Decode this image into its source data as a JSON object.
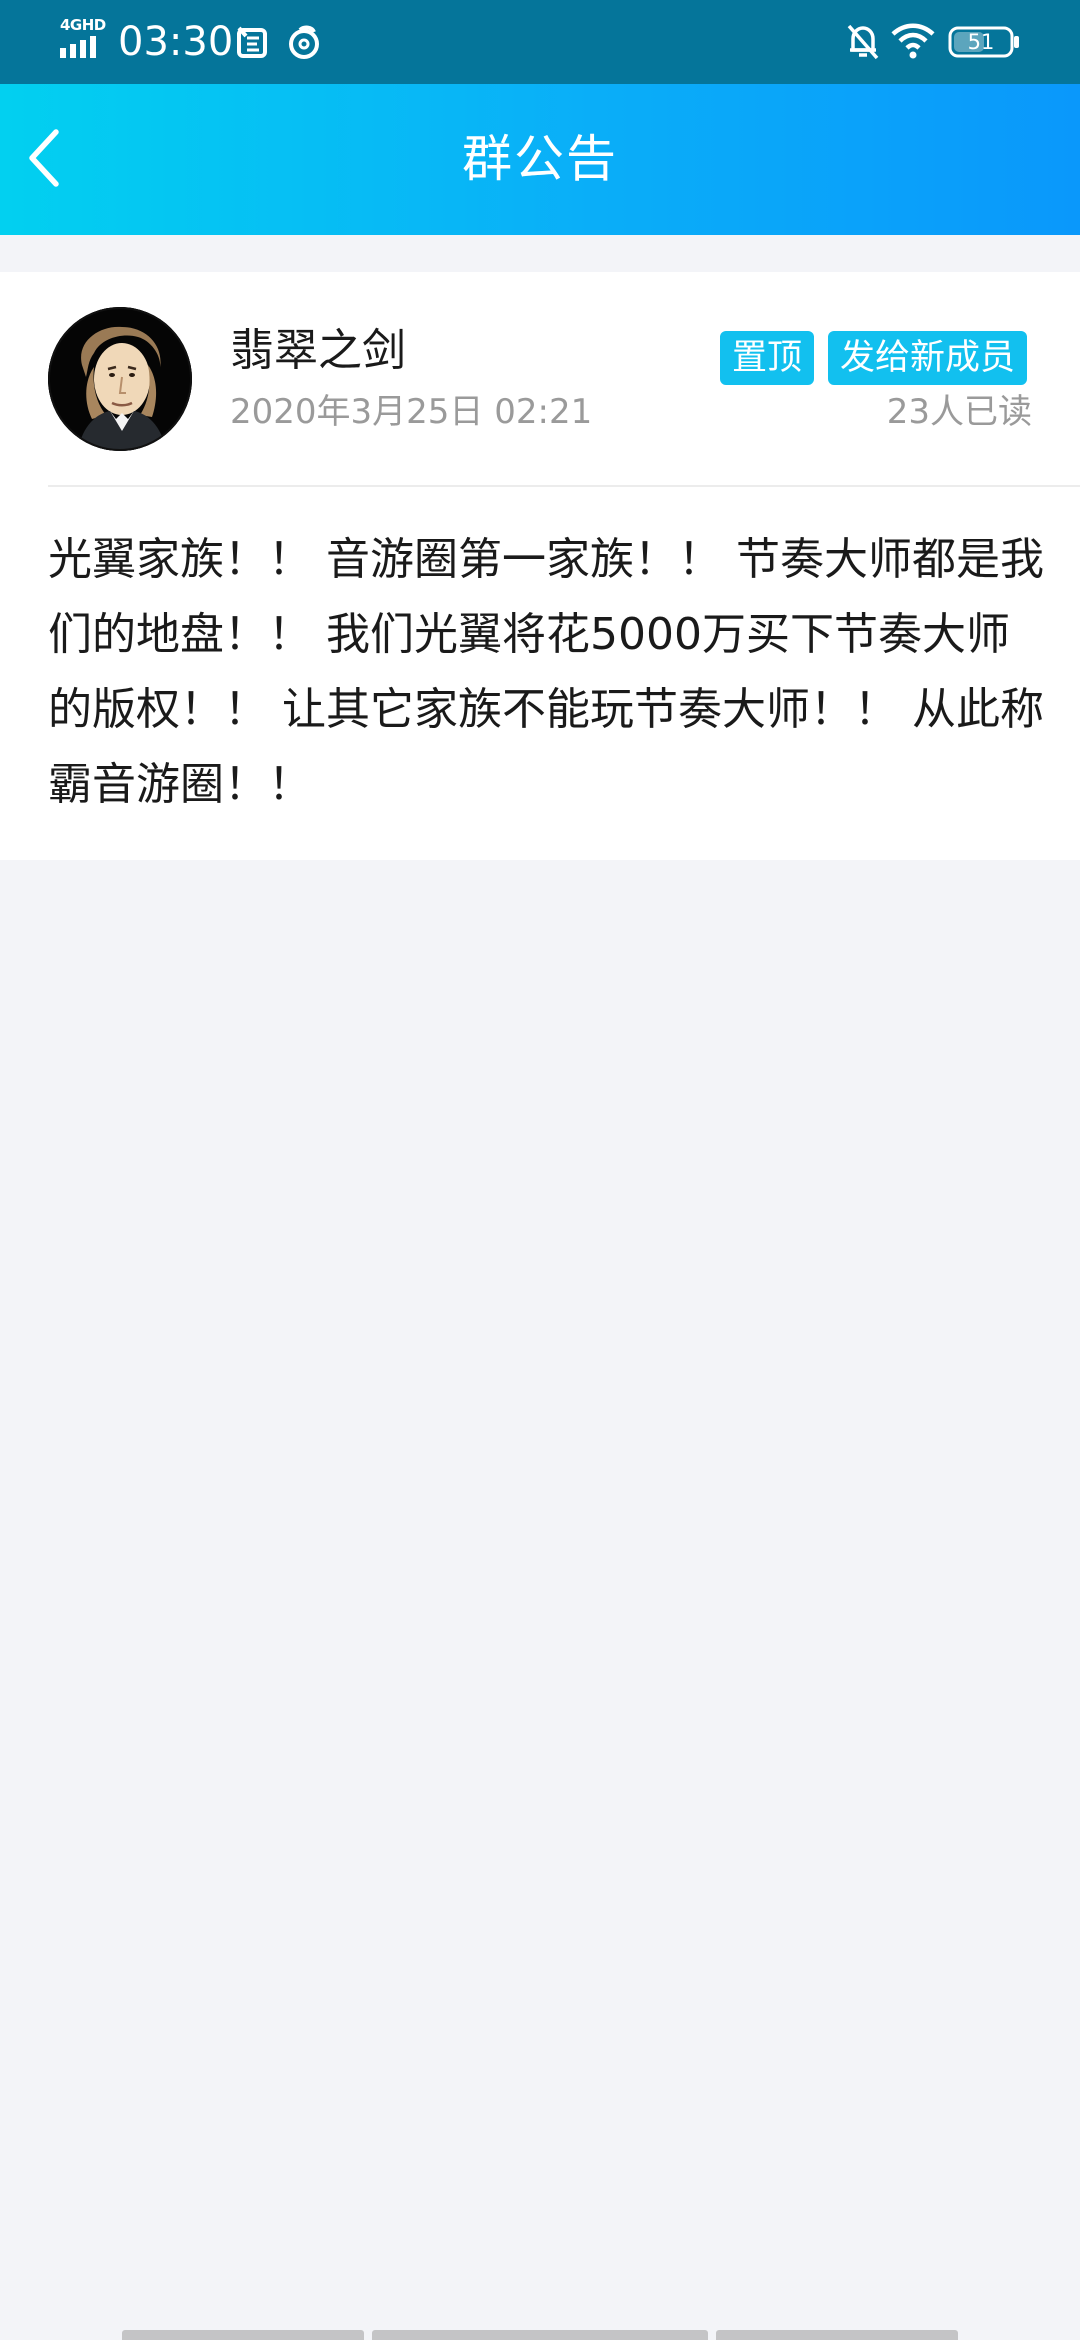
{
  "status_bar": {
    "network": "4GHD",
    "time": "03:30",
    "battery": "51"
  },
  "header": {
    "title": "群公告"
  },
  "announcement": {
    "author": "翡翠之剑",
    "date": "2020年3月25日 02:21",
    "tags": [
      "置顶",
      "发给新成员"
    ],
    "read_count": "23人已读",
    "content": "光翼家族！！ 音游圈第一家族！！ 节奏大师都是我们的地盘！！ 我们光翼将花5000万买下节奏大师的版权！！ 让其它家族不能玩节奏大师！！ 从此称霸音游圈！！"
  },
  "colors": {
    "status_bar_bg": "#05759a",
    "header_gradient_start": "#02d0f0",
    "header_gradient_end": "#0a98fb",
    "tag_bg": "#12c0ef",
    "page_bg": "#f3f4f8"
  }
}
